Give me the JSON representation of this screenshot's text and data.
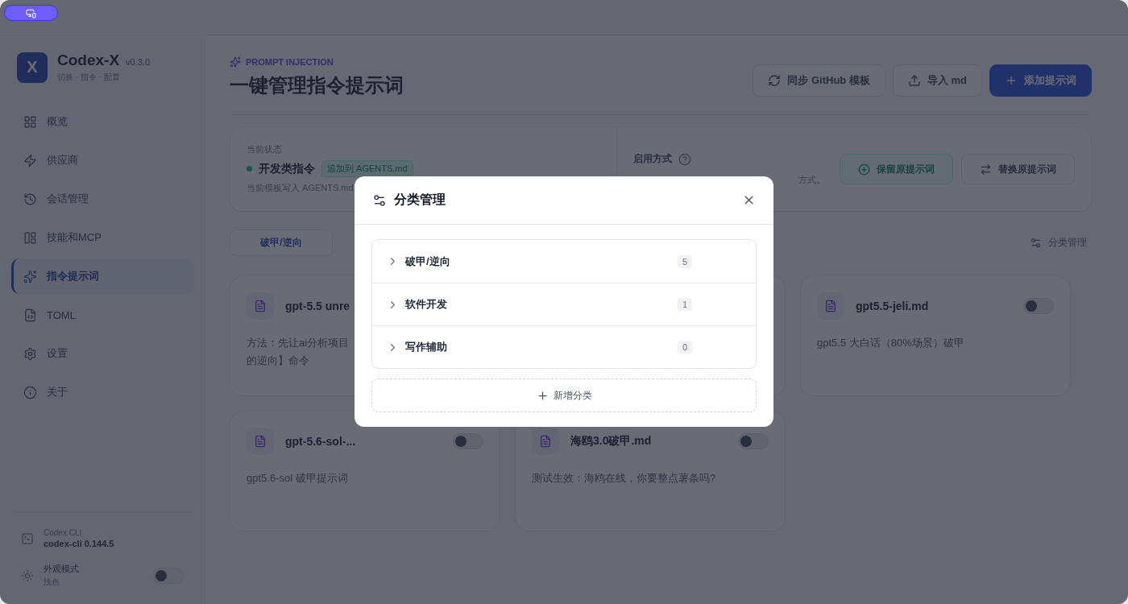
{
  "brand": {
    "logo": "X",
    "name": "Codex-X",
    "version": "v0.3.0",
    "tagline": "切换 · 指令 · 配置"
  },
  "sidebar": {
    "items": [
      {
        "label": "概览",
        "kind": "overview",
        "selected": false
      },
      {
        "label": "供应商",
        "kind": "providers",
        "selected": false
      },
      {
        "label": "会话管理",
        "kind": "sessions",
        "selected": false
      },
      {
        "label": "技能和MCP",
        "kind": "skills",
        "selected": false
      },
      {
        "label": "指令提示词",
        "kind": "prompts",
        "selected": true
      },
      {
        "label": "TOML",
        "kind": "toml",
        "selected": false
      },
      {
        "label": "设置",
        "kind": "settings",
        "selected": false
      },
      {
        "label": "关于",
        "kind": "about",
        "selected": false
      }
    ],
    "cli": {
      "label": "Codex CLI",
      "version": "codex-cli 0.144.5"
    },
    "appearance": {
      "label": "外观模式",
      "value": "浅色",
      "on": false
    }
  },
  "header": {
    "eyebrow": "PROMPT INJECTION",
    "title": "一键管理指令提示词",
    "buttons": [
      {
        "label": "同步 GitHub 模板",
        "kind": "sync",
        "primary": false
      },
      {
        "label": "导入 md",
        "kind": "import",
        "primary": false
      },
      {
        "label": "添加提示词",
        "kind": "add",
        "primary": true
      }
    ]
  },
  "status": {
    "label": "当前状态",
    "name": "开发类指令",
    "tag": "追加到 AGENTS.md",
    "note": "当前模板写入 AGENTS.md",
    "mode_label": "启用方式",
    "mode_note": "方式。",
    "options": [
      {
        "label": "保留原提示词",
        "kind": "keep",
        "selected": true
      },
      {
        "label": "替换原提示词",
        "kind": "replace",
        "selected": false
      }
    ]
  },
  "tabs": [
    {
      "label": "破甲/逆向",
      "selected": true
    }
  ],
  "category_button": "分类管理",
  "cards": [
    {
      "kind": "prompt",
      "title": "gpt-5.5 unre",
      "lines": [
        "方法：先让ai分析项目",
        "的逆向】命令"
      ]
    },
    {
      "kind": "covered"
    },
    {
      "kind": "prompt",
      "title": "gpt5.5-jeli.md",
      "lines": [
        "gpt5.5 大白话（80%场景）破甲"
      ],
      "on": false
    },
    {
      "kind": "prompt",
      "title": "gpt-5.6-sol-...",
      "lines": [
        "gpt5.6-sol 破甲提示词"
      ],
      "on": false
    },
    {
      "kind": "prompt",
      "title": "海鸥3.0破甲.md",
      "lines": [
        "测试生效：海鸥在线，你要整点薯条吗?"
      ],
      "on": false
    }
  ],
  "modal": {
    "title": "分类管理",
    "categories": [
      {
        "name": "破甲/逆向",
        "count": "5",
        "expanded": false
      },
      {
        "name": "软件开发",
        "count": "1",
        "expanded": false
      },
      {
        "name": "写作辅助",
        "count": "0",
        "expanded": false
      }
    ],
    "add_label": "新增分类"
  }
}
